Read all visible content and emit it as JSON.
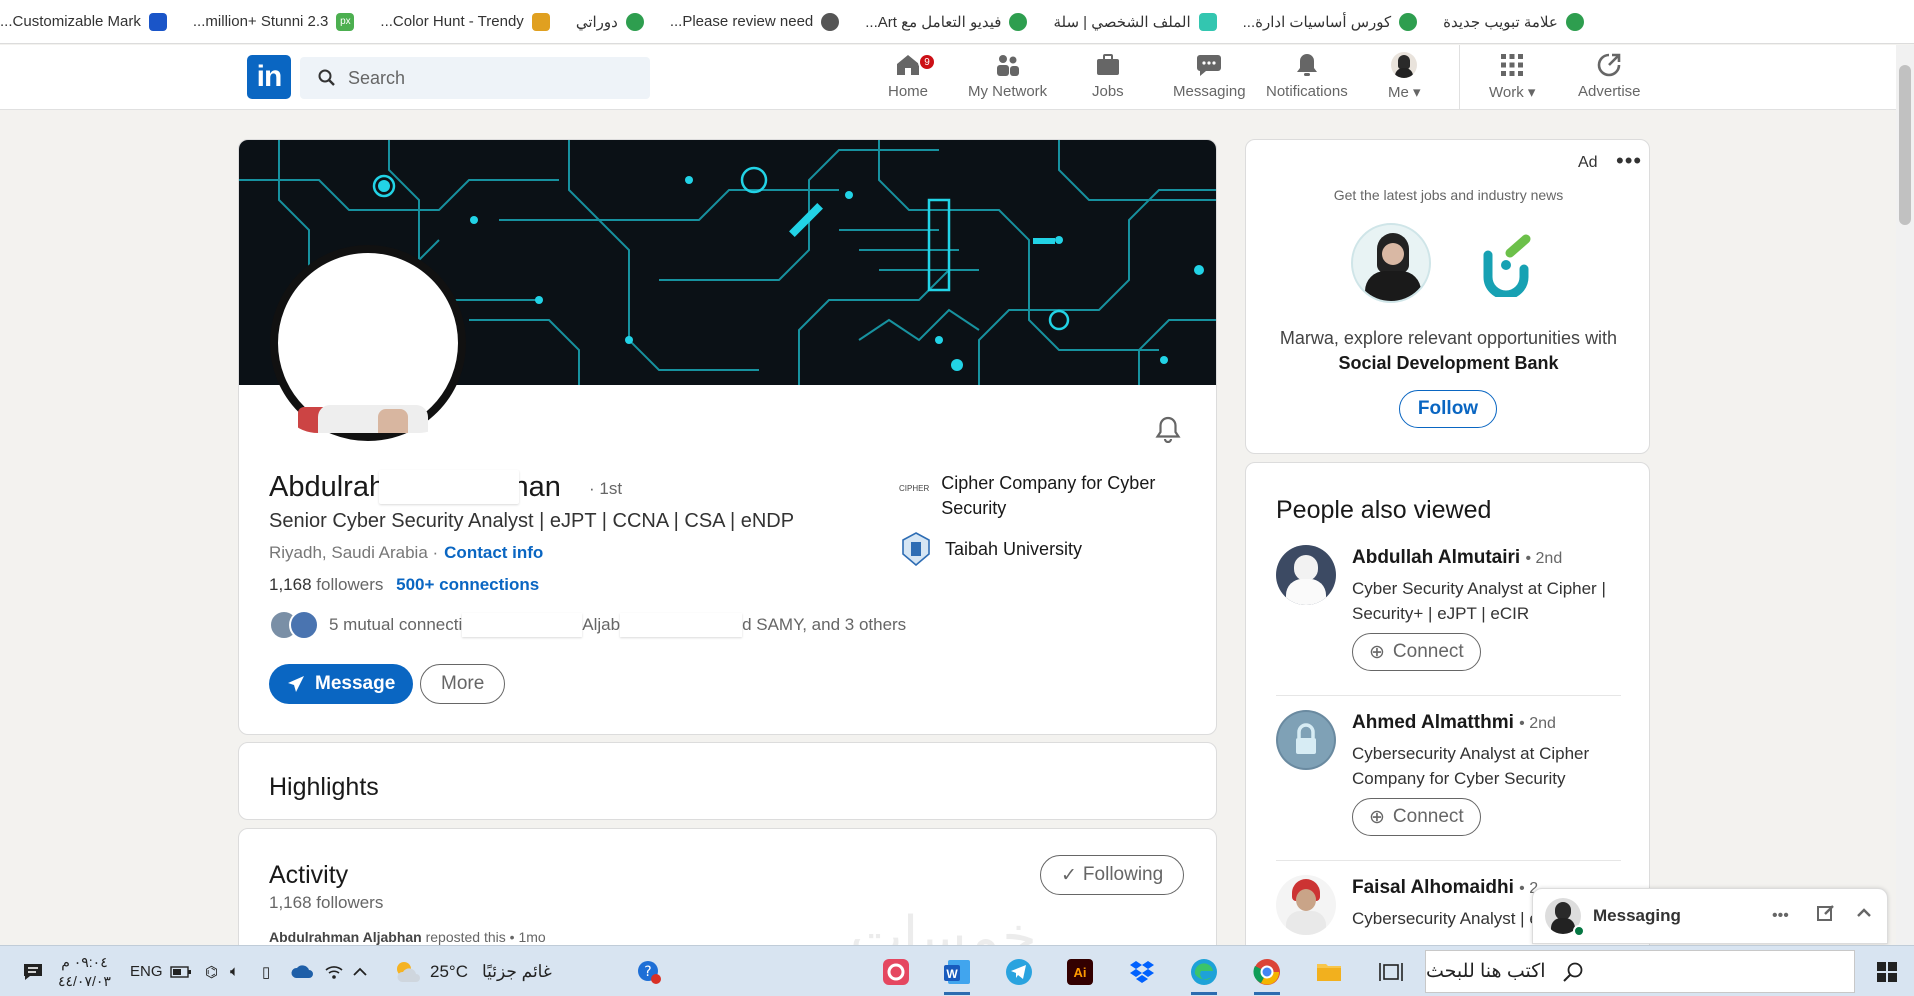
{
  "bookmarks": [
    {
      "label": "علامة تبويب جديدة",
      "icon": "chrome-new-tab-icon",
      "color": "#2e9e4f"
    },
    {
      "label": "كورس أساسيات ادارة...",
      "icon": "course-site-icon",
      "color": "#2e9e4f"
    },
    {
      "label": "الملف الشخصي | سلة",
      "icon": "salla-icon",
      "color": "#33c6b0"
    },
    {
      "label": "فيديو التعامل مع Art...",
      "icon": "video-site-icon",
      "color": "#2e9e4f"
    },
    {
      "label": "Please review need...",
      "icon": "globe-icon",
      "color": "#555555"
    },
    {
      "label": "دوراتي",
      "icon": "courses-site-icon",
      "color": "#2e9e4f"
    },
    {
      "label": "Color Hunt - Trendy...",
      "icon": "colorhunt-icon",
      "color": "#e0a020"
    },
    {
      "label": "2.3 million+ Stunni...",
      "icon": "pixabay-icon",
      "color": "#4caf50"
    },
    {
      "label": "Customizable Mark...",
      "icon": "mark-site-icon",
      "color": "#1a55c8"
    }
  ],
  "header": {
    "search_placeholder": "Search",
    "nav": [
      {
        "label": "Home",
        "icon": "home-icon",
        "badge": "9"
      },
      {
        "label": "My Network",
        "icon": "my-network-icon"
      },
      {
        "label": "Jobs",
        "icon": "jobs-icon"
      },
      {
        "label": "Messaging",
        "icon": "messaging-icon"
      },
      {
        "label": "Notifications",
        "icon": "notifications-icon"
      },
      {
        "label": "Me",
        "icon": "me-avatar-icon"
      },
      {
        "label": "Work",
        "icon": "work-grid-icon"
      },
      {
        "label": "Advertise",
        "icon": "advertise-icon"
      }
    ]
  },
  "profile": {
    "name": "Abdulrahman Aljabhan",
    "degree": "· 1st",
    "headline": "Senior Cyber Security Analyst | eJPT | CCNA | CSA | eNDP",
    "location": "Riyadh, Saudi Arabia ·",
    "contact_info": "Contact info",
    "followers_count": "1,168",
    "followers_word": "followers",
    "connections": "500+ connections",
    "mutual_a": "5 mutual connecti",
    "mutual_b": "Aljab",
    "mutual_c": "d SAMY, and 3 others",
    "message_button": "Message",
    "more_button": "More",
    "companies": [
      {
        "name": "Cipher Company for Cyber Security",
        "logo_text": "CIPHER"
      },
      {
        "name": "Taibah University",
        "logo_text": ""
      }
    ]
  },
  "highlights": {
    "title": "Highlights"
  },
  "activity": {
    "title": "Activity",
    "followers": "1,168 followers",
    "following_button": "Following",
    "repost_author": "Abdulrahman Aljabhan",
    "repost_text": "reposted this • 1mo"
  },
  "ad": {
    "label": "Ad",
    "subtitle": "Get the latest jobs and industry news",
    "text_prefix": "Marwa, explore relevant opportunities with",
    "company": "Social Development Bank",
    "follow_button": "Follow"
  },
  "people_also_viewed": {
    "title": "People also viewed",
    "people": [
      {
        "name": "Abdullah Almutairi",
        "degree": "• 2nd",
        "title": "Cyber Security Analyst at Cipher | Security+ | eJPT | eCIR",
        "button": "Connect"
      },
      {
        "name": "Ahmed Almatthmi",
        "degree": "• 2nd",
        "title": "Cybersecurity Analyst at Cipher Company for Cyber Security",
        "button": "Connect"
      },
      {
        "name": "Faisal Alhomaidhi",
        "degree": "• 2",
        "title": "Cybersecurity Analyst | e",
        "button": ""
      }
    ]
  },
  "messaging": {
    "label": "Messaging"
  },
  "taskbar": {
    "search_placeholder": "اكتب هنا للبحث",
    "weather_temp": "25°C",
    "weather_text": "غائم جزئيًا",
    "lang": "ENG",
    "time": "٠٩:٠٤ م",
    "date": "٤٤/٠٧/٠٣"
  },
  "watermark": "خمسات",
  "colors": {
    "linkedin_blue": "#0a66c2",
    "badge_red": "#cc1016",
    "cover_cyan": "#22d3e6"
  }
}
